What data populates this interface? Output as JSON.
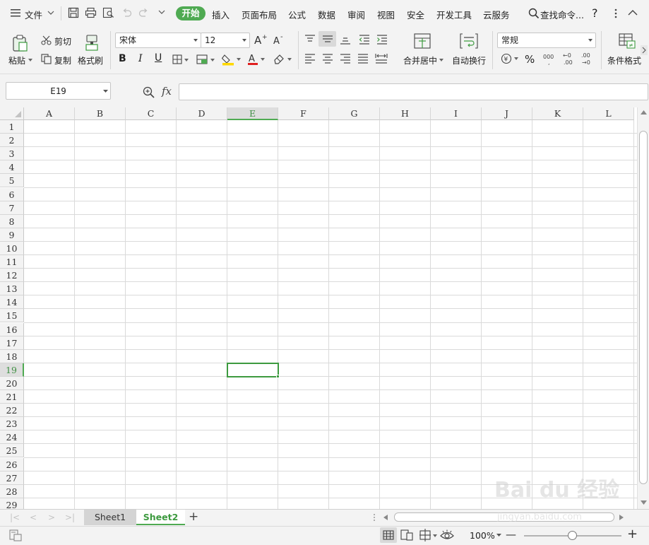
{
  "menubar": {
    "file_label": "文件",
    "tabs": [
      {
        "label": "开始",
        "active": true
      },
      {
        "label": "插入"
      },
      {
        "label": "页面布局"
      },
      {
        "label": "公式"
      },
      {
        "label": "数据"
      },
      {
        "label": "审阅"
      },
      {
        "label": "视图"
      },
      {
        "label": "安全"
      },
      {
        "label": "开发工具"
      },
      {
        "label": "云服务"
      }
    ],
    "search_label": "查找命令...",
    "help_label": "?"
  },
  "ribbon": {
    "paste_label": "粘贴",
    "cut_label": "剪切",
    "copy_label": "复制",
    "format_painter_label": "格式刷",
    "font_name": "宋体",
    "font_size": "12",
    "bold": "B",
    "italic": "I",
    "underline": "U",
    "font_color_glyph": "A",
    "merge_center_label": "合并居中",
    "wrap_text_label": "自动换行",
    "number_format": "常规",
    "percent_glyph": "%",
    "thousands_glyph": "000",
    "inc_decimal_glyph": "+.0\n.00",
    "dec_decimal_glyph": ".00\n+.0",
    "conditional_format_label": "条件格式"
  },
  "formula": {
    "name_box": "E19",
    "fx_label": "fx",
    "content": ""
  },
  "grid": {
    "columns": [
      "A",
      "B",
      "C",
      "D",
      "E",
      "F",
      "G",
      "H",
      "I",
      "J",
      "K",
      "L"
    ],
    "rows": [
      "1",
      "2",
      "3",
      "4",
      "5",
      "6",
      "7",
      "8",
      "9",
      "10",
      "11",
      "12",
      "13",
      "14",
      "15",
      "16",
      "17",
      "18",
      "19",
      "20",
      "21",
      "22",
      "23",
      "24",
      "25",
      "26",
      "27",
      "28",
      "29"
    ],
    "active_column": "E",
    "active_row": "19"
  },
  "sheets": {
    "tabs": [
      {
        "label": "Sheet1",
        "active": false
      },
      {
        "label": "Sheet2",
        "active": true
      }
    ],
    "add_label": "+"
  },
  "statusbar": {
    "zoom": "100%",
    "zoom_minus": "—",
    "zoom_plus": "+"
  },
  "colors": {
    "accent": "#4faa52",
    "selection": "#3d9a3f"
  },
  "watermark": {
    "brand": "Bai du 经验",
    "url": "jingyan.baidu.com"
  }
}
